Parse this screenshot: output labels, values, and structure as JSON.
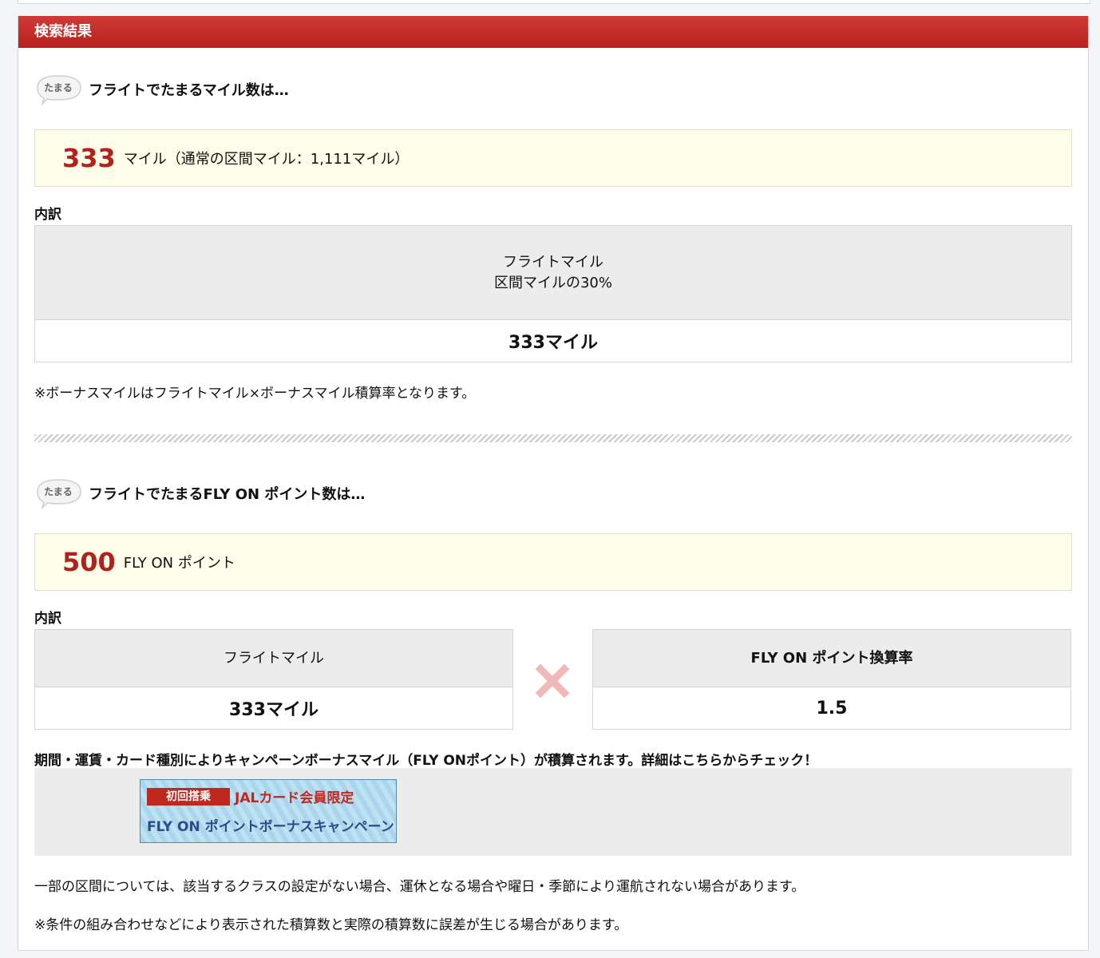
{
  "panel": {
    "title": "検索結果"
  },
  "badge": {
    "label": "たまる"
  },
  "miles": {
    "heading": "フライトでたまるマイル数は…",
    "value": "333",
    "unit_text": "マイル（通常の区間マイル：1,111マイル）",
    "breakdown_label": "内訳",
    "table": {
      "head_line1": "フライトマイル",
      "head_line2": "区間マイルの30%",
      "value": "333マイル"
    },
    "note": "※ボーナスマイルはフライトマイル×ボーナスマイル積算率となります。"
  },
  "flyon": {
    "heading": "フライトでたまるFLY ON ポイント数は…",
    "value": "500",
    "unit_text": "FLY ON ポイント",
    "breakdown_label": "内訳",
    "left_table": {
      "head": "フライトマイル",
      "value": "333マイル"
    },
    "right_table": {
      "head": "FLY ON ポイント換算率",
      "value": "1.5"
    },
    "campaign_note": "期間・運賃・カード種別によりキャンペーンボーナスマイル（FLY ONポイント）が積算されます。詳細はこちらからチェック！",
    "banner": {
      "tag": "初回搭乗",
      "title1": "JALカード会員限定",
      "title2": "FLY ON ポイントボーナスキャンペーン"
    }
  },
  "footnotes": {
    "line1": "一部の区間については、該当するクラスの設定がない場合、運休となる場合や曜日・季節により運航されない場合があります。",
    "line2": "※条件の組み合わせなどにより表示された積算数と実際の積算数に誤差が生じる場合があります。"
  },
  "colors": {
    "header_red": "#b8221f",
    "number_red": "#b3211c",
    "result_bg": "#fdfdea",
    "table_head_bg": "#ececec",
    "times_mark": "#f2b8b5"
  }
}
